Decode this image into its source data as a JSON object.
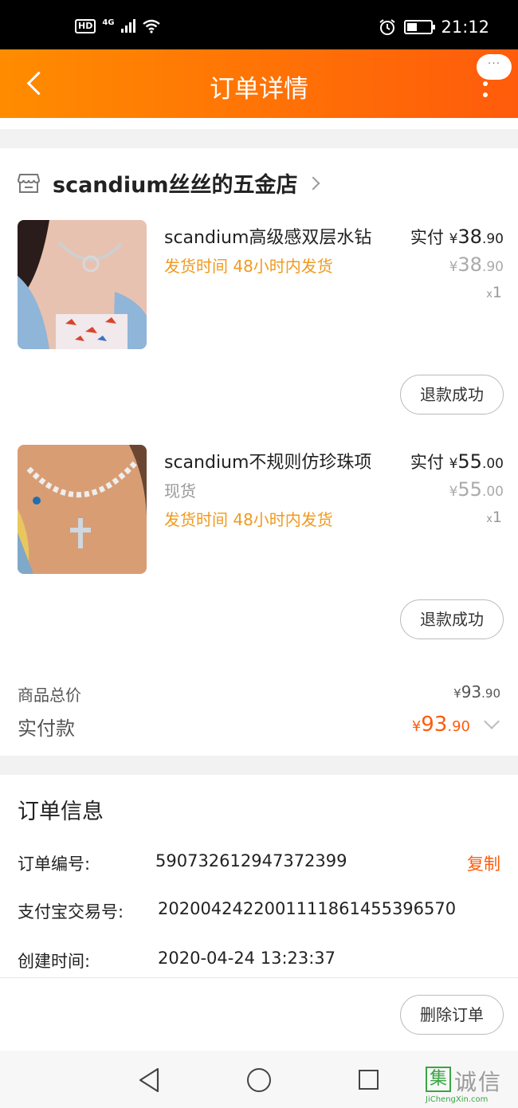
{
  "status_bar": {
    "hd": "HD",
    "network": "4G",
    "time": "21:12"
  },
  "header": {
    "title": "订单详情",
    "more_bubble": "···"
  },
  "shop": {
    "name": "scandium丝丝的五金店"
  },
  "items": [
    {
      "title": "scandium高级感双层水钻",
      "stock": "",
      "ship_label": "发货时间",
      "ship_value": "48小时内发货",
      "paid_label": "实付",
      "currency": "¥",
      "paid_int": "38",
      "paid_dec": ".90",
      "orig_int": "38",
      "orig_dec": ".90",
      "qty_x": "x",
      "qty": "1",
      "status_button": "退款成功"
    },
    {
      "title": "scandium不规则仿珍珠项",
      "stock": "现货",
      "ship_label": "发货时间",
      "ship_value": "48小时内发货",
      "paid_label": "实付",
      "currency": "¥",
      "paid_int": "55",
      "paid_dec": ".00",
      "orig_int": "55",
      "orig_dec": ".00",
      "qty_x": "x",
      "qty": "1",
      "status_button": "退款成功"
    }
  ],
  "summary": {
    "total_label": "商品总价",
    "total_currency": "¥",
    "total_int": "93",
    "total_dec": ".90",
    "pay_label": "实付款",
    "pay_currency": "¥",
    "pay_int": "93",
    "pay_dec": ".90"
  },
  "order_info": {
    "title": "订单信息",
    "order_no_label": "订单编号:",
    "order_no": "590732612947372399",
    "copy": "复制",
    "alipay_label": "支付宝交易号:",
    "alipay_no": "2020042422001111861455396570",
    "created_label": "创建时间:",
    "created": "2020-04-24 13:23:37"
  },
  "footer": {
    "delete_button": "删除订单"
  },
  "watermark": {
    "box": "集",
    "text": "诚信",
    "sub": "JiChengXin.com"
  },
  "colors": {
    "header_start": "#ff8c00",
    "header_end": "#ff5b0b",
    "accent": "#ff5b0b",
    "ship_orange": "#f09a20"
  }
}
